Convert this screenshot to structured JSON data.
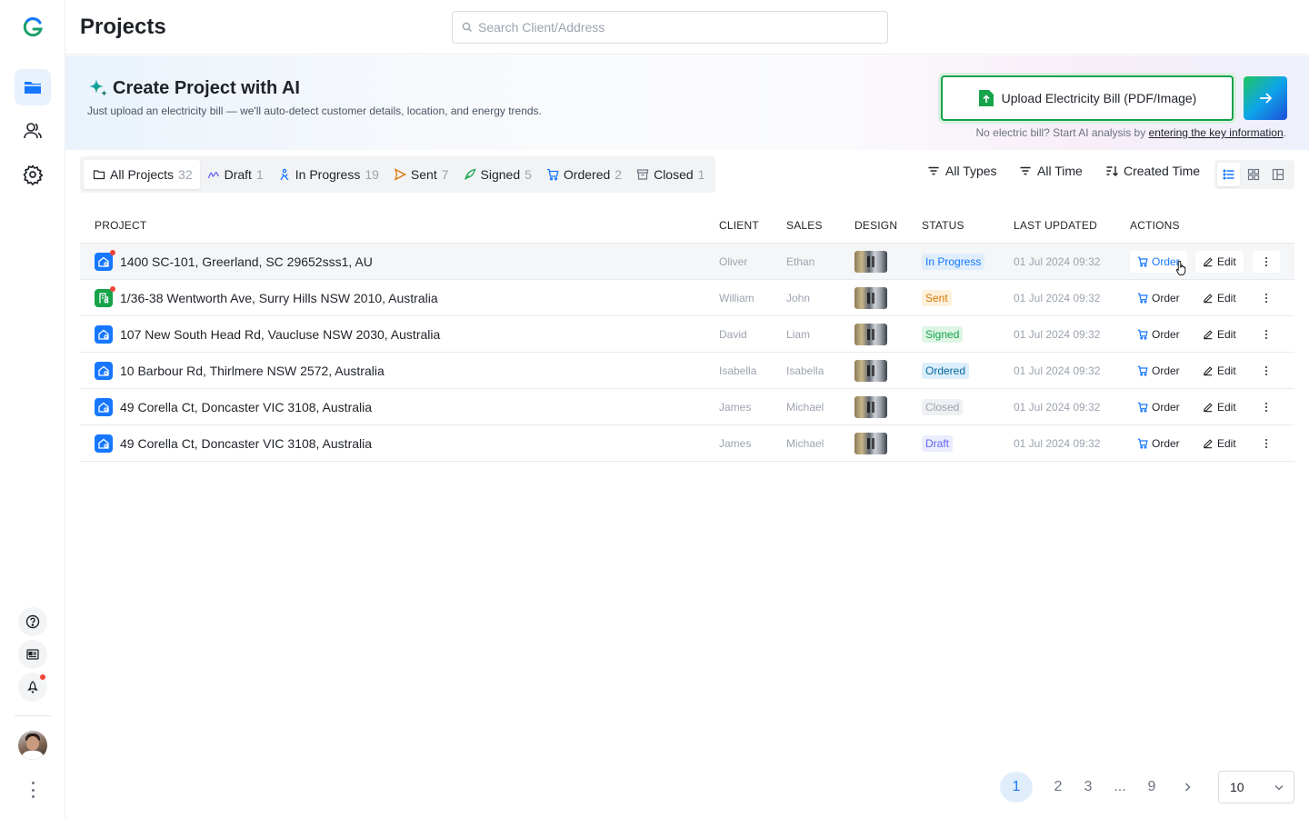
{
  "header": {
    "title": "Projects",
    "search_placeholder": "Search Client/Address"
  },
  "ai_banner": {
    "title": "Create Project with AI",
    "subtitle": "Just upload an electricity bill — we'll auto-detect customer details, location, and energy trends.",
    "upload_label": "Upload Electricity Bill (PDF/Image)",
    "no_bill_text": "No electric bill? Start AI analysis by ",
    "no_bill_link": "entering the key information",
    "no_bill_end": "."
  },
  "tabs": [
    {
      "label": "All Projects",
      "count": "32",
      "icon": "folder-icon"
    },
    {
      "label": "Draft",
      "count": "1",
      "icon": "draft-icon"
    },
    {
      "label": "In Progress",
      "count": "19",
      "icon": "progress-icon"
    },
    {
      "label": "Sent",
      "count": "7",
      "icon": "send-icon"
    },
    {
      "label": "Signed",
      "count": "5",
      "icon": "sign-icon"
    },
    {
      "label": "Ordered",
      "count": "2",
      "icon": "cart-icon"
    },
    {
      "label": "Closed",
      "count": "1",
      "icon": "archive-icon"
    }
  ],
  "filters": {
    "type": "All Types",
    "time": "All Time",
    "sort": "Created Time"
  },
  "table": {
    "columns": {
      "project": "PROJECT",
      "client": "CLIENT",
      "sales": "SALES",
      "design": "DESIGN",
      "status": "STATUS",
      "updated": "LAST UPDATED",
      "actions": "ACTIONS"
    },
    "order_label": "Order",
    "edit_label": "Edit",
    "rows": [
      {
        "address": "1400 SC-101, Greerland, SC 29652sss1, AU",
        "client": "Oliver",
        "sales": "Ethan",
        "status": "In Progress",
        "updated": "01 Jul 2024 09:32"
      },
      {
        "address": "1/36-38 Wentworth Ave, Surry Hills NSW 2010, Australia",
        "client": "William",
        "sales": "John",
        "status": "Sent",
        "updated": "01 Jul 2024 09:32"
      },
      {
        "address": "107 New South Head Rd, Vaucluse NSW 2030, Australia",
        "client": "David",
        "sales": "Liam",
        "status": "Signed",
        "updated": "01 Jul 2024 09:32"
      },
      {
        "address": "10 Barbour Rd, Thirlmere NSW 2572, Australia",
        "client": "Isabella",
        "sales": "Isabella",
        "status": "Ordered",
        "updated": "01 Jul 2024 09:32"
      },
      {
        "address": "49 Corella Ct, Doncaster VIC 3108, Australia",
        "client": "James",
        "sales": "Michael",
        "status": "Closed",
        "updated": "01 Jul 2024 09:32"
      },
      {
        "address": "49 Corella Ct, Doncaster VIC 3108, Australia",
        "client": "James",
        "sales": "Michael",
        "status": "Draft",
        "updated": "01 Jul 2024 09:32"
      }
    ]
  },
  "pagination": {
    "pages": [
      "1",
      "2",
      "3",
      "...",
      "9"
    ],
    "current": "1",
    "page_size": "10"
  },
  "colors": {
    "accent": "#1677ff",
    "upload_border": "#16a34a",
    "status_in_progress": "#1677ff",
    "status_sent": "#d97706",
    "status_signed": "#16a34a",
    "status_ordered": "#0284c7",
    "status_closed": "#9ca3af",
    "status_draft": "#6366f1"
  }
}
